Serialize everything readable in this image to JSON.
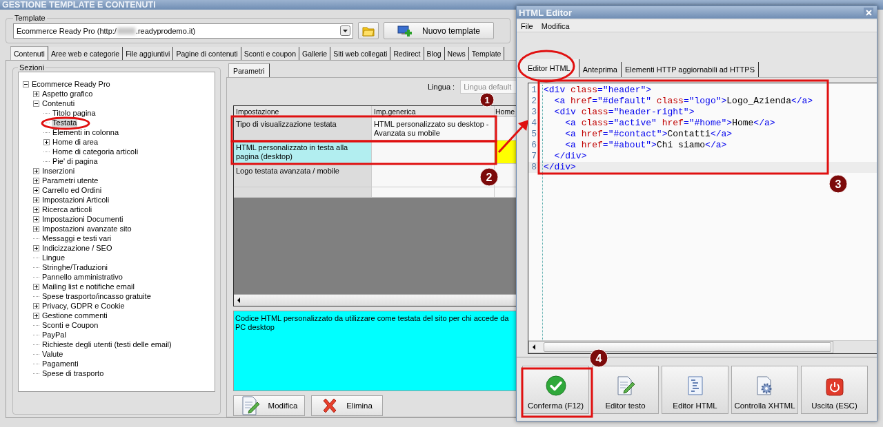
{
  "main_window": {
    "title": "GESTIONE TEMPLATE E CONTENUTI",
    "template": {
      "label": "Template",
      "value_prefix": "Ecommerce Ready Pro (http:/",
      "value_suffix": ".readyprodemo.it)",
      "new_button": "Nuovo template"
    },
    "tabs": [
      {
        "label": "Contenuti",
        "selected": true
      },
      {
        "label": "Aree web e categorie",
        "selected": false
      },
      {
        "label": "File aggiuntivi",
        "selected": false
      },
      {
        "label": "Pagine di contenuti",
        "selected": false
      },
      {
        "label": "Sconti e coupon",
        "selected": false
      },
      {
        "label": "Gallerie",
        "selected": false
      },
      {
        "label": "Siti web collegati",
        "selected": false
      },
      {
        "label": "Redirect",
        "selected": false
      },
      {
        "label": "Blog",
        "selected": false
      },
      {
        "label": "News",
        "selected": false
      },
      {
        "label": "Template",
        "selected": false
      }
    ],
    "sections": {
      "label": "Sezioni",
      "tree": [
        {
          "label": "Ecommerce Ready Pro",
          "expanded": true,
          "selected": false,
          "children": [
            {
              "label": "Aspetto grafico",
              "expanded": false,
              "selected": false
            },
            {
              "label": "Contenuti",
              "expanded": true,
              "selected": false,
              "children": [
                {
                  "label": "Titolo pagina",
                  "selected": false
                },
                {
                  "label": "Testata",
                  "selected": true
                },
                {
                  "label": "Elementi in colonna",
                  "selected": false
                },
                {
                  "label": "Home di area",
                  "expanded": false,
                  "selected": false
                },
                {
                  "label": "Home di categoria articoli",
                  "selected": false
                },
                {
                  "label": "Pie' di pagina",
                  "selected": false
                }
              ]
            },
            {
              "label": "Inserzioni",
              "expanded": false,
              "selected": false
            },
            {
              "label": "Parametri utente",
              "expanded": false,
              "selected": false
            },
            {
              "label": "Carrello ed Ordini",
              "expanded": false,
              "selected": false
            },
            {
              "label": "Impostazioni Articoli",
              "expanded": false,
              "selected": false
            },
            {
              "label": "Ricerca articoli",
              "expanded": false,
              "selected": false
            },
            {
              "label": "Impostazioni Documenti",
              "expanded": false,
              "selected": false
            },
            {
              "label": "Impostazioni avanzate sito",
              "expanded": false,
              "selected": false
            },
            {
              "label": "Messaggi e testi vari",
              "selected": false
            },
            {
              "label": "Indicizzazione / SEO",
              "expanded": false,
              "selected": false
            },
            {
              "label": "Lingue",
              "selected": false
            },
            {
              "label": "Stringhe/Traduzioni",
              "selected": false
            },
            {
              "label": "Pannello amministrativo",
              "selected": false
            },
            {
              "label": "Mailing list e notifiche email",
              "expanded": false,
              "selected": false
            },
            {
              "label": "Spese trasporto/incasso gratuite",
              "selected": false
            },
            {
              "label": "Privacy, GDPR e Cookie",
              "expanded": false,
              "selected": false
            },
            {
              "label": "Gestione commenti",
              "expanded": false,
              "selected": false
            },
            {
              "label": "Sconti e Coupon",
              "selected": false
            },
            {
              "label": "PayPal",
              "selected": false
            },
            {
              "label": "Richieste degli utenti (testi delle email)",
              "selected": false
            },
            {
              "label": "Valute",
              "selected": false
            },
            {
              "label": "Pagamenti",
              "selected": false
            },
            {
              "label": "Spese di trasporto",
              "selected": false
            }
          ]
        }
      ]
    },
    "parameters": {
      "tab": "Parametri",
      "language_label": "Lingua :",
      "language_value": "Lingua default",
      "columns": [
        "Impostazione",
        "Imp.generica",
        "Home"
      ],
      "rows": [
        {
          "setting": "Tipo di visualizzazione testata",
          "value": "HTML personalizzato su desktop - Avanzata su mobile",
          "selected": false
        },
        {
          "setting": "HTML personalizzato in testa alla pagina (desktop)",
          "selected": true
        },
        {
          "setting": "Logo testata avanzata / mobile",
          "selected": false
        }
      ],
      "description": "Codice HTML personalizzato da utilizzare come testata del sito per chi accede da PC desktop",
      "buttons": [
        {
          "kind": "edit",
          "label": "Modifica"
        },
        {
          "kind": "delete",
          "label": "Elimina"
        }
      ]
    }
  },
  "html_editor": {
    "title": "HTML Editor",
    "menu": [
      "File",
      "Modifica"
    ],
    "tabs": [
      {
        "label": "Editor HTML",
        "selected": true
      },
      {
        "label": "Anteprima",
        "selected": false
      },
      {
        "label": "Elementi HTTP aggiornabili ad HTTPS",
        "selected": false
      }
    ],
    "code_lines": [
      {
        "number": "1",
        "text": "<div class=\"header\">",
        "selected": false
      },
      {
        "number": "2",
        "text": "  <a href=\"#default\" class=\"logo\">Logo_Azienda</a>",
        "selected": false
      },
      {
        "number": "3",
        "text": "  <div class=\"header-right\">",
        "selected": false
      },
      {
        "number": "4",
        "text": "    <a class=\"active\" href=\"#home\">Home</a>",
        "selected": false
      },
      {
        "number": "5",
        "text": "    <a href=\"#contact\">Contatti</a>",
        "selected": false
      },
      {
        "number": "6",
        "text": "    <a href=\"#about\">Chi siamo</a>",
        "selected": false
      },
      {
        "number": "7",
        "text": "  </div>",
        "selected": false
      },
      {
        "number": "8",
        "text": "</div>",
        "selected": true
      }
    ],
    "buttons": [
      {
        "kind": "confirm",
        "label": "Conferma (F12)"
      },
      {
        "kind": "text_editor",
        "label": "Editor testo"
      },
      {
        "kind": "html_editor",
        "label": "Editor HTML"
      },
      {
        "kind": "validate",
        "label": "Controlla XHTML"
      },
      {
        "kind": "exit",
        "label": "Uscita (ESC)"
      }
    ]
  },
  "annotations": {
    "badges": [
      "1",
      "2",
      "3",
      "4"
    ]
  }
}
